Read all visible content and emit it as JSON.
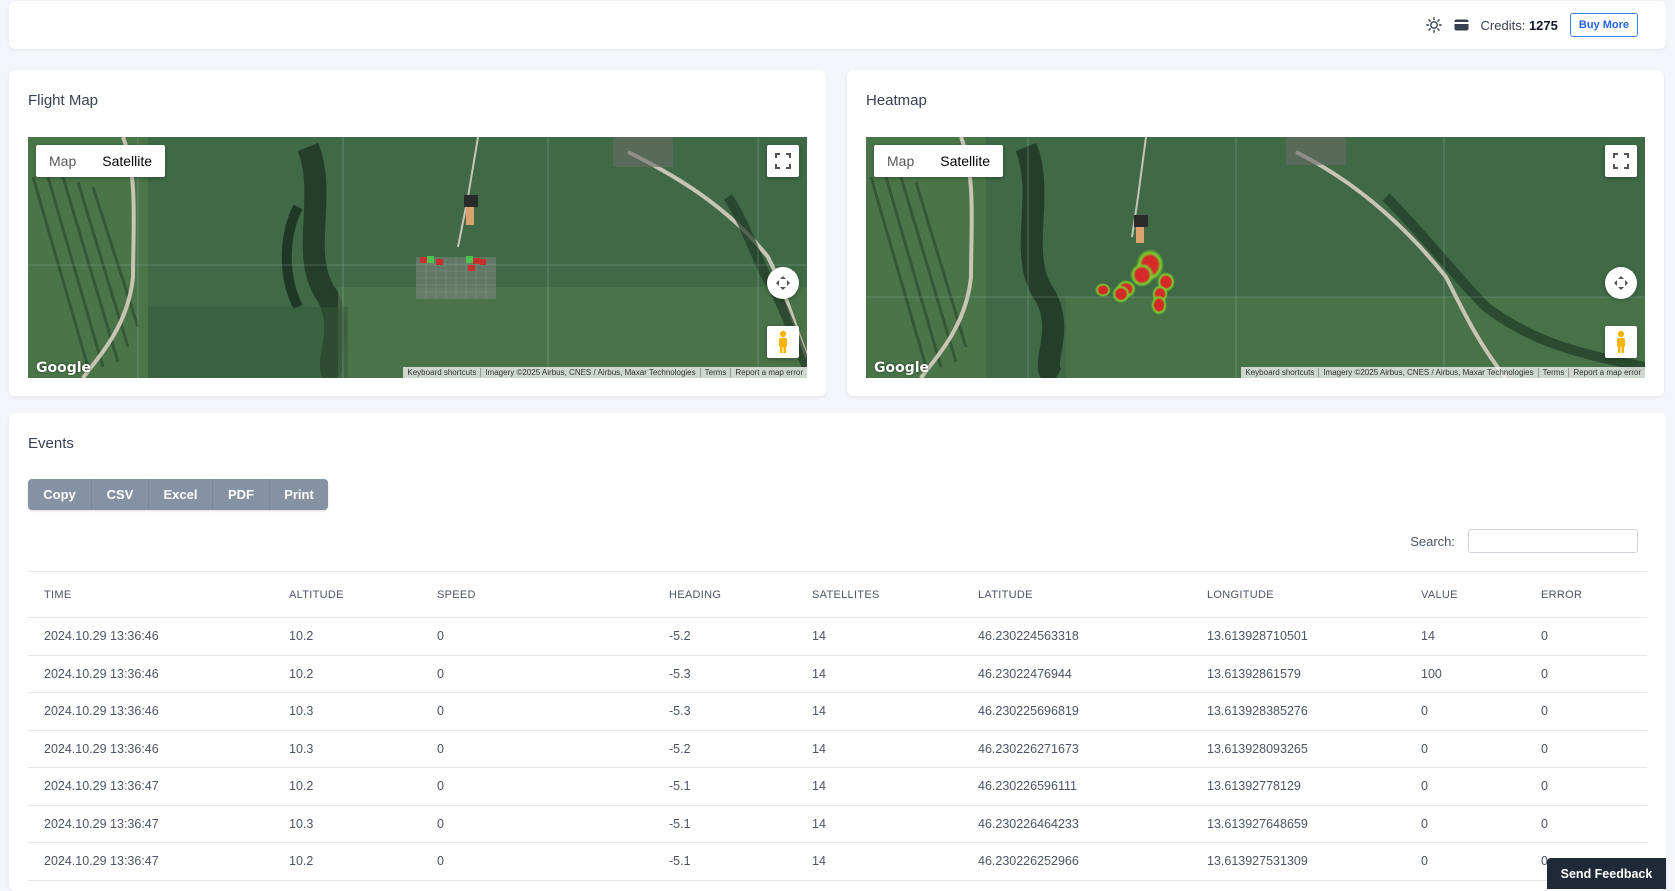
{
  "topbar": {
    "theme_icon": "sun-icon",
    "credit_icon": "credit-card-icon",
    "credits_label": "Credits:",
    "credits_value": "1275",
    "buy_more_label": "Buy More"
  },
  "flight_map": {
    "title": "Flight Map",
    "map_type_map": "Map",
    "map_type_satellite": "Satellite",
    "active_map_type": "Satellite",
    "google_logo": "Google",
    "attribution": {
      "shortcuts": "Keyboard shortcuts",
      "imagery": "Imagery ©2025 Airbus, CNES / Airbus, Maxar Technologies",
      "terms": "Terms",
      "report": "Report a map error"
    }
  },
  "heatmap": {
    "title": "Heatmap",
    "map_type_map": "Map",
    "map_type_satellite": "Satellite",
    "active_map_type": "Satellite",
    "google_logo": "Google",
    "attribution": {
      "shortcuts": "Keyboard shortcuts",
      "imagery": "Imagery ©2025 Airbus, CNES / Airbus, Maxar Technologies",
      "terms": "Terms",
      "report": "Report a map error"
    }
  },
  "events": {
    "title": "Events",
    "export_buttons": [
      "Copy",
      "CSV",
      "Excel",
      "PDF",
      "Print"
    ],
    "search_label": "Search:",
    "search_value": "",
    "columns": [
      "TIME",
      "ALTITUDE",
      "SPEED",
      "HEADING",
      "SATELLITES",
      "LATITUDE",
      "LONGITUDE",
      "VALUE",
      "ERROR"
    ],
    "rows": [
      [
        "2024.10.29 13:36:46",
        "10.2",
        "0",
        "-5.2",
        "14",
        "46.230224563318",
        "13.613928710501",
        "14",
        "0"
      ],
      [
        "2024.10.29 13:36:46",
        "10.2",
        "0",
        "-5.3",
        "14",
        "46.23022476944",
        "13.61392861579",
        "100",
        "0"
      ],
      [
        "2024.10.29 13:36:46",
        "10.3",
        "0",
        "-5.3",
        "14",
        "46.230225696819",
        "13.613928385276",
        "0",
        "0"
      ],
      [
        "2024.10.29 13:36:46",
        "10.3",
        "0",
        "-5.2",
        "14",
        "46.230226271673",
        "13.613928093265",
        "0",
        "0"
      ],
      [
        "2024.10.29 13:36:47",
        "10.2",
        "0",
        "-5.1",
        "14",
        "46.230226596111",
        "13.61392778129",
        "0",
        "0"
      ],
      [
        "2024.10.29 13:36:47",
        "10.3",
        "0",
        "-5.1",
        "14",
        "46.230226464233",
        "13.613927648659",
        "0",
        "0"
      ],
      [
        "2024.10.29 13:36:47",
        "10.2",
        "0",
        "-5.1",
        "14",
        "46.230226252966",
        "13.613927531309",
        "0",
        "0"
      ]
    ]
  },
  "feedback_label": "Send Feedback",
  "colors": {
    "page_bg": "#f4f5fa",
    "export_button": "#8592a3",
    "feedback_bg": "#1f2937",
    "buy_more_border": "#3b82f6",
    "heat_hot": "#d62a2a",
    "heat_warm": "#7bd12c"
  }
}
